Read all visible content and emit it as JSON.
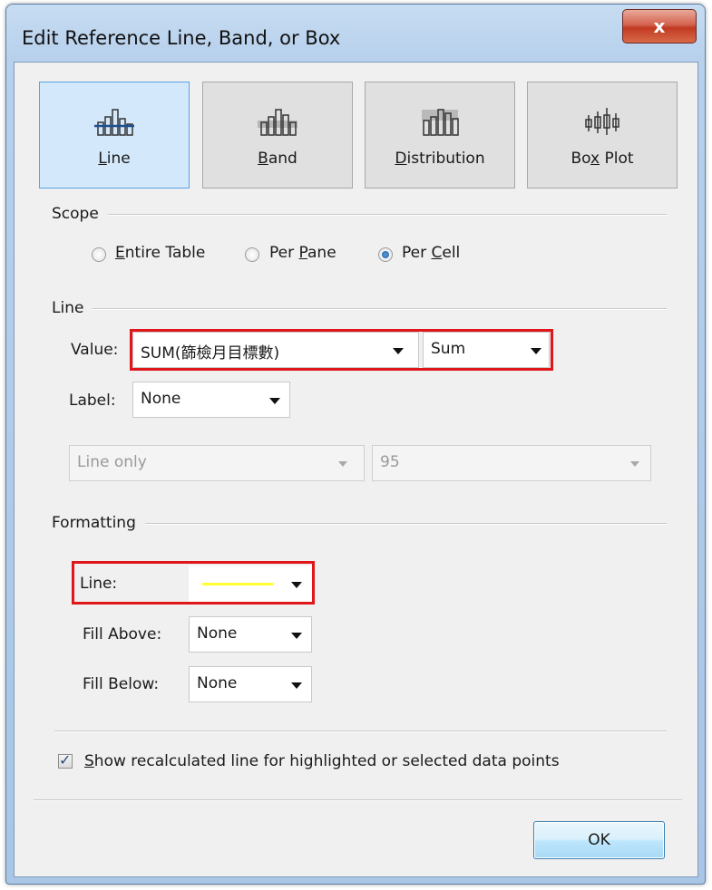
{
  "window": {
    "title": "Edit Reference Line, Band, or Box",
    "close_glyph": "x"
  },
  "tiles": [
    {
      "label_pre": "",
      "label_key": "L",
      "label_post": "ine",
      "icon": "reference-line-icon"
    },
    {
      "label_pre": "",
      "label_key": "B",
      "label_post": "and",
      "icon": "reference-band-icon"
    },
    {
      "label_pre": "",
      "label_key": "D",
      "label_post": "istribution",
      "icon": "distribution-icon"
    },
    {
      "label_pre": "Bo",
      "label_key": "x",
      "label_post": " Plot",
      "icon": "box-plot-icon"
    }
  ],
  "scope": {
    "header": "Scope",
    "options": [
      {
        "pre": "",
        "key": "E",
        "post": "ntire Table",
        "checked": false
      },
      {
        "pre": "Per ",
        "key": "P",
        "post": "ane",
        "checked": false
      },
      {
        "pre": "Per ",
        "key": "C",
        "post": "ell",
        "checked": true
      }
    ]
  },
  "line_section": {
    "header": "Line",
    "value_label": "Value:",
    "value_field": "SUM(篩檢月目標數)",
    "aggregation": "Sum",
    "label_label": "Label:",
    "label_value": "None",
    "line_type": "Line only",
    "percentile": "95"
  },
  "formatting": {
    "header": "Formatting",
    "line_label": "Line:",
    "line_color": "#ffff33",
    "fill_above_label": "Fill Above:",
    "fill_above_value": "None",
    "fill_below_label": "Fill Below:",
    "fill_below_value": "None"
  },
  "options": {
    "show_recalc_key": "S",
    "show_recalc_rest": "how recalculated line for highlighted or selected data points",
    "show_recalc_checked": true,
    "check_glyph": "✓"
  },
  "buttons": {
    "ok_label": "OK"
  },
  "colors": {
    "highlight": "#e0161b",
    "selected_tile": "#d4e8fb"
  }
}
